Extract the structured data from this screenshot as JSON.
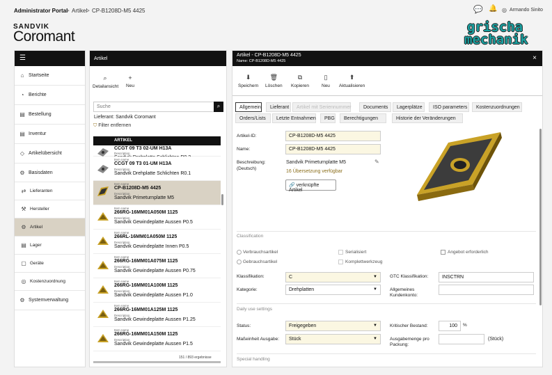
{
  "topbar": {
    "portal": "Administrator Portal",
    "crumb1": "Artikel",
    "crumb2": "CP-B1208D-M5 4425",
    "sep": ">",
    "user": "Armando Sinito"
  },
  "logo": {
    "line1": "SANDVIK",
    "line2": "Coromant"
  },
  "brand": {
    "line1": "grischa",
    "line2": "mechanik"
  },
  "sidebar": {
    "items": [
      {
        "label": "Startseite",
        "icon": "home-icon",
        "glyph": "⌂"
      },
      {
        "label": "Berichte",
        "icon": "chart-icon",
        "glyph": "◔"
      },
      {
        "label": "Bestellung",
        "icon": "document-icon",
        "glyph": "▤"
      },
      {
        "label": "Inventur",
        "icon": "document-icon",
        "glyph": "▤"
      },
      {
        "label": "Artikelübersicht",
        "icon": "tag-icon",
        "glyph": "◇"
      },
      {
        "label": "Basisdaten",
        "icon": "gear-icon",
        "glyph": "⚙"
      }
    ],
    "subitems": [
      {
        "label": "Lieferanten",
        "glyph": "⇄"
      },
      {
        "label": "Hersteller",
        "glyph": "⚒"
      },
      {
        "label": "Artikel",
        "glyph": "⚙"
      },
      {
        "label": "Lager",
        "glyph": "▤"
      },
      {
        "label": "Geräte",
        "glyph": "▢"
      },
      {
        "label": "Kostenzuordnung",
        "glyph": "◎"
      }
    ],
    "last": {
      "label": "Systemverwaltung",
      "glyph": "⚙"
    }
  },
  "list": {
    "title": "Artikel",
    "tb_detail": "Detailansicht",
    "tb_new": "Neu",
    "search_placeholder": "Suche",
    "supplier": "Lieferant:  Sandvik Coromant",
    "filter": "Filter entfernen",
    "column": "ARTIKEL",
    "item_name_lbl": "Item name",
    "desc_lbl": "Description",
    "footer": "151 / 893 ergebnisse",
    "rows": [
      {
        "code": "CCGT 09 T3 02-UM H13A",
        "desc": "Sandvik Drehplatte Schlichten R0.2"
      },
      {
        "code": "CCGT 09 T3 01-UM H13A",
        "desc": "Sandvik Drehplatte Schlichten R0.1"
      },
      {
        "code": "CP-B1208D-M5 4425",
        "desc": "Sandvik Primeturnplatte M5"
      },
      {
        "code": "266RG-16MM01A050M 1125",
        "desc": "Sandvik Gewindeplatte Aussen P0.5"
      },
      {
        "code": "266RL-16MM01A050M 1125",
        "desc": "Sandvik Gewindeplatte Innen P0.5"
      },
      {
        "code": "266RG-16MM01A075M 1125",
        "desc": "Sandvik Gewindeplatte Aussen P0.75"
      },
      {
        "code": "266RG-16MM01A100M 1125",
        "desc": "Sandvik Gewindeplatte Aussen P1.0"
      },
      {
        "code": "266RG-16MM01A125M 1125",
        "desc": "Sandvik Gewindeplatte Aussen P1.25"
      },
      {
        "code": "266RG-16MM01A150M 1125",
        "desc": "Sandvik Gewindeplatte Aussen P1.5"
      }
    ]
  },
  "detail": {
    "title": "Artikel - CP-B1208D-M5 4425",
    "subtitle": "Name: CP-B1208D-M5 4425",
    "toolbar": [
      "Speichern",
      "Löschen",
      "Kopieren",
      "Neu",
      "Aktualisieren"
    ],
    "tabs_row1": [
      "Allgemein",
      "Lieferant",
      "Artikel mit Seriennummer",
      "Documents",
      "Lagerplätze",
      "ISO parameters",
      "Kostenzuordnungen"
    ],
    "tabs_row2": [
      "Orders/Lists",
      "Letzte Entnahmen",
      "PBG",
      "Berechtigungen",
      "Historie der Veränderungen"
    ],
    "artikel_id_lbl": "Artikel-ID:",
    "artikel_id": "CP-B1208D-M5        4425",
    "name_lbl": "Name:",
    "name": "CP-B1208D-M5        4425",
    "beschreibung_lbl": "Beschreibung:",
    "beschreibung_lbl2": "(Deutsch)",
    "beschreibung": "Sandvik Primeturnplatte M5",
    "translations": "16 Übersetzung verfügbar",
    "linked_btn": "verknüpfte Artikel",
    "classification": "Classification",
    "verbrauch": "Verbrauchsartikel",
    "gebrauch": "Gebrauchsartikel",
    "serialisiert": "Serialisiert",
    "komplett": "Komplettwerkzeug",
    "angebot": "Angebot erforderlich",
    "klass_lbl": "Klassifikation:",
    "klass": "C",
    "gtc_lbl": "GTC Klassifikation:",
    "gtc": "INSCTRN",
    "kat_lbl": "Kategorie:",
    "kat": "Drehplatten",
    "kunden_lbl1": "Allgemeines",
    "kunden_lbl2": "Kundenkonto:",
    "daily": "Daily use settings",
    "status_lbl": "Status:",
    "status": "Freigegeben",
    "krit_lbl": "Kritischer Bestand:",
    "krit": "100",
    "krit_unit": "%",
    "mass_lbl": "Maßeinheit Ausgabe:",
    "mass": "Stück",
    "ausgabe_lbl1": "Ausgabemenge pro",
    "ausgabe_lbl2": "Packung:",
    "ausgabe_unit": "(Stück)",
    "special": "Special handling"
  },
  "colors": {
    "accent_bg": "#d9d2c4",
    "field_bg": "#fbf7e2",
    "brand": "#1aa0a0",
    "insert_gold": "#c9a227"
  }
}
